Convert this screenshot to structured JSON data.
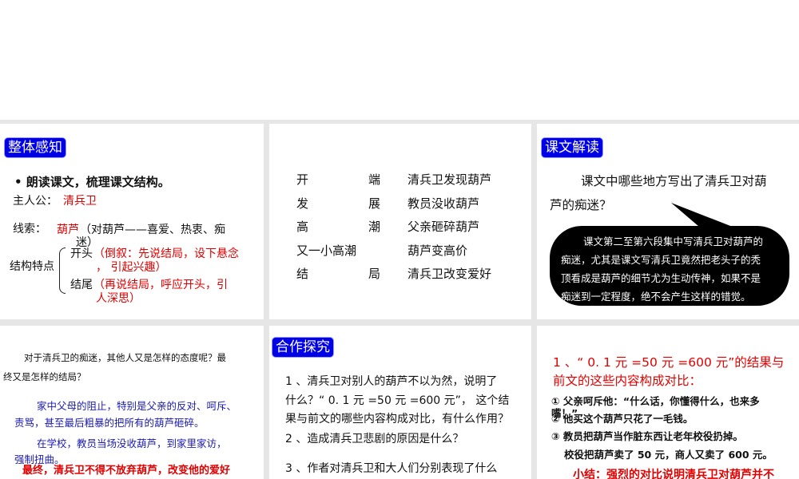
{
  "p1": {
    "tag": "整体感知",
    "bullet": "• 朗读课文，梳理课文结构。",
    "hero_label": "主人公：",
    "hero": "清兵卫",
    "clue_label": "线索：",
    "clue": "葫芦",
    "clue_note1": "（对葫芦——喜爱、热衷、痴",
    "clue_note2": "迷）",
    "struct_label": "结构特点",
    "open_label": "开头",
    "open_note1": "（倒叙：先说结局，设下悬念",
    "open_note2": "，  引起兴趣）",
    "end_label": "结尾",
    "end_note1": "（再说结局，呼应开头，引",
    "end_note2": "人深思）"
  },
  "p2": {
    "rows": [
      {
        "a": "开",
        "b": "端",
        "c": "清兵卫发现葫芦"
      },
      {
        "a": "发",
        "b": "展",
        "c": "教员没收葫芦"
      },
      {
        "a": "高",
        "b": "潮",
        "c": "父亲砸碎葫芦"
      },
      {
        "a": "又一小高潮",
        "b": "",
        "c": "葫芦变高价"
      },
      {
        "a": "结",
        "b": "局",
        "c": "清兵卫改变爱好"
      }
    ]
  },
  "p3": {
    "tag": "课文解读",
    "q1": "课文中哪些地方写出了清兵卫对葫",
    "q2": "芦的痴迷？",
    "a": [
      "课文第二至第六段集中写清兵卫对葫芦的",
      "痴迷，尤其是课文写清兵卫竟然把老头子的秃",
      "顶看成是葫芦的细节尤为生动传神，如果不是",
      "痴迷到一定程度，绝不会产生这样的错觉。"
    ]
  },
  "p4": {
    "q1": "对于清兵卫的痴迷，其他人又是怎样的态度呢？最",
    "q2": "终又是怎样的结局？",
    "b1a": "家中父母的阻止，特别是父亲的反对、呵斥、",
    "b1b": "责骂，甚至最后粗暴的把所有的葫芦砸碎。",
    "b2a": "在学校，教员当场没收葫芦，到家里家访，",
    "b2b": "强制扭曲。",
    "r": "最终，清兵卫不得不放弃葫芦，改变他的爱好"
  },
  "p5": {
    "tag": "合作探究",
    "q1a": "1 、清兵卫对别人的葫芦不以为然，说明了",
    "q1b": "什么？“ 0. 1 元 =50 元 =600 元”， 这个结",
    "q1c": "果与前文的哪些内容构成对比，有什么作用？",
    "q2": "2 、造成清兵卫悲剧的原因是什么？",
    "q3": "3 、作者对清兵卫和大人们分别表现了什么"
  },
  "p6": {
    "h1": "1 、“ 0. 1 元 =50 元 =600 元”的结果与",
    "h2": "前文的这些内容构成对比：",
    "i1": "① 父亲呵斥他：“什么话，你懂得什么，也来多",
    "i1b": "嘴！”",
    "i2": "② 他买这个葫芦只花了一毛钱。",
    "i3": "③ 教员把葫芦当作脏东西让老年校役扔掉。",
    "i4": "校役把葫芦卖了 50 元，商人又卖了 600 元。",
    "sum": "小结：强烈的对比说明清兵卫对葫芦并不"
  }
}
